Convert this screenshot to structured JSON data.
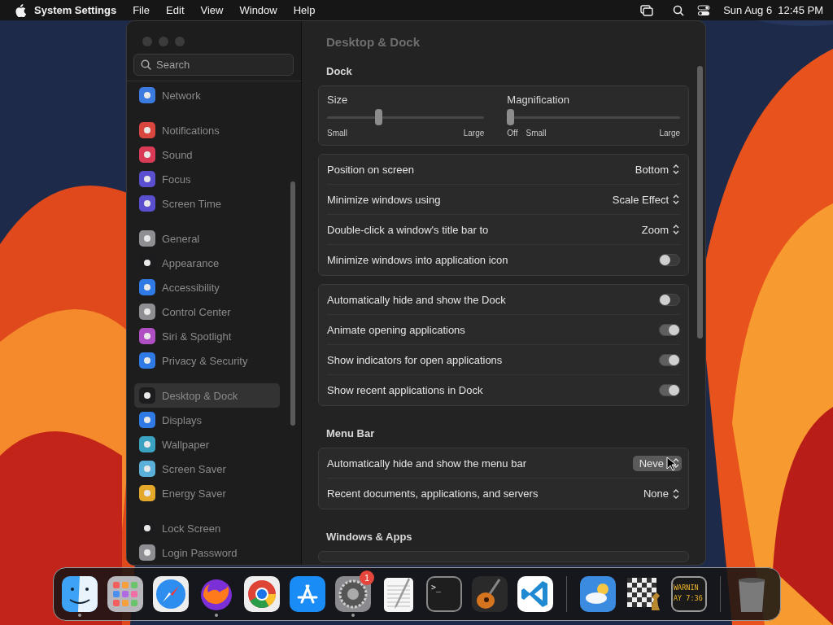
{
  "menu_bar": {
    "app": "System Settings",
    "menus": [
      "File",
      "Edit",
      "View",
      "Window",
      "Help"
    ],
    "clock": "Sun Aug 6  12:45 PM"
  },
  "window": {
    "title": "Desktop & Dock"
  },
  "sidebar": {
    "search": {
      "placeholder": "Search"
    },
    "groups": [
      [
        {
          "label": "Network",
          "selected": false,
          "color": "#3b7be0"
        }
      ],
      [
        {
          "label": "Notifications",
          "selected": false,
          "color": "#d9453f"
        },
        {
          "label": "Sound",
          "selected": false,
          "color": "#d93a55"
        },
        {
          "label": "Focus",
          "selected": false,
          "color": "#5a4fcf"
        },
        {
          "label": "Screen Time",
          "selected": false,
          "color": "#5a4fcf"
        }
      ],
      [
        {
          "label": "General",
          "selected": false,
          "color": "#8e8e93"
        },
        {
          "label": "Appearance",
          "selected": false,
          "color": "#1c1c1e"
        },
        {
          "label": "Accessibility",
          "selected": false,
          "color": "#2f7ae5"
        },
        {
          "label": "Control Center",
          "selected": false,
          "color": "#8e8e93"
        },
        {
          "label": "Siri & Spotlight",
          "selected": false,
          "color": "#b04fc4"
        },
        {
          "label": "Privacy & Security",
          "selected": false,
          "color": "#2f7ae5"
        }
      ],
      [
        {
          "label": "Desktop & Dock",
          "selected": true,
          "color": "#1c1c1e"
        },
        {
          "label": "Displays",
          "selected": false,
          "color": "#2f7ae5"
        },
        {
          "label": "Wallpaper",
          "selected": false,
          "color": "#3aa3c2"
        },
        {
          "label": "Screen Saver",
          "selected": false,
          "color": "#5ab0d8"
        },
        {
          "label": "Energy Saver",
          "selected": false,
          "color": "#e3a829"
        }
      ],
      [
        {
          "label": "Lock Screen",
          "selected": false,
          "color": "#1c1c1e"
        },
        {
          "label": "Login Password",
          "selected": false,
          "color": "#8e8e93"
        }
      ]
    ]
  },
  "sections": [
    {
      "title": "Dock",
      "cards": [
        {
          "kind": "sliders",
          "sliders": [
            {
              "label": "Size",
              "level": 0.32,
              "ticks": [
                "Small",
                "Large"
              ]
            },
            {
              "label": "Magnification",
              "level": 0,
              "ticks": [
                "Off",
                "Small",
                "Large"
              ]
            }
          ]
        },
        {
          "kind": "rows",
          "rows": [
            {
              "kind": "select",
              "label": "Position on screen",
              "value": "Bottom",
              "hovered": false
            },
            {
              "kind": "select",
              "label": "Minimize windows using",
              "value": "Scale Effect",
              "hovered": false
            },
            {
              "kind": "select",
              "label": "Double-click a window's title bar to",
              "value": "Zoom",
              "hovered": false
            },
            {
              "kind": "toggle",
              "label": "Minimize windows into application icon",
              "on": false
            }
          ]
        },
        {
          "kind": "rows",
          "rows": [
            {
              "kind": "toggle",
              "label": "Automatically hide and show the Dock",
              "on": false
            },
            {
              "kind": "toggle",
              "label": "Animate opening applications",
              "on": true
            },
            {
              "kind": "toggle",
              "label": "Show indicators for open applications",
              "on": true
            },
            {
              "kind": "toggle",
              "label": "Show recent applications in Dock",
              "on": true
            }
          ]
        }
      ]
    },
    {
      "title": "Menu Bar",
      "cards": [
        {
          "kind": "rows",
          "rows": [
            {
              "kind": "select",
              "label": "Automatically hide and show the menu bar",
              "value": "Neve",
              "hovered": true
            },
            {
              "kind": "select",
              "label": "Recent documents, applications, and servers",
              "value": "None",
              "hovered": false
            }
          ]
        }
      ]
    },
    {
      "title": "Windows & Apps",
      "cards": [
        {
          "kind": "rows"
        }
      ]
    }
  ],
  "dock": [
    {
      "kind": "finder",
      "running": true
    },
    {
      "kind": "launchpad",
      "running": false
    },
    {
      "kind": "safari",
      "running": false
    },
    {
      "kind": "firefox",
      "running": true
    },
    {
      "kind": "chrome",
      "running": false
    },
    {
      "kind": "appstore",
      "running": false
    },
    {
      "kind": "settings",
      "running": true,
      "badge": "1"
    },
    {
      "kind": "textedit",
      "running": false
    },
    {
      "kind": "terminal",
      "running": false,
      "text": ">_"
    },
    {
      "kind": "guitar",
      "running": false
    },
    {
      "kind": "vscode",
      "running": false
    },
    {
      "kind": "separator"
    },
    {
      "kind": "weather",
      "running": false
    },
    {
      "kind": "chess",
      "running": false
    },
    {
      "kind": "console",
      "running": false,
      "lines": [
        "WARNIN",
        "AY 7:36"
      ]
    },
    {
      "kind": "separator"
    },
    {
      "kind": "trash",
      "running": false
    }
  ]
}
